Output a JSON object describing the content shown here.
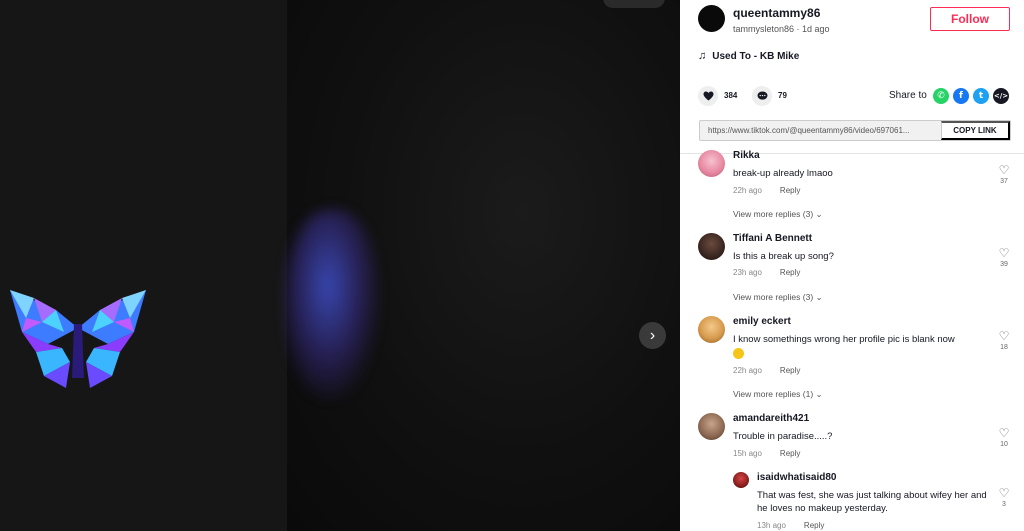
{
  "post": {
    "author_handle": "queentammy86",
    "author_subline": "tammysleton86 · 1d ago",
    "follow_label": "Follow",
    "music": "Used To - KB Mike",
    "likes": "384",
    "comments": "79",
    "share_label": "Share to",
    "link": "https://www.tiktok.com/@queentammy86/video/697061...",
    "copy_link_label": "COPY LINK"
  },
  "video": {
    "next_icon": "›"
  },
  "comments": [
    {
      "name": "Rikka",
      "text": "break-up already lmaoo",
      "time": "22h ago",
      "reply": "Reply",
      "likes": "37",
      "view_more": "View more replies (3) ⌄"
    },
    {
      "name": "Tiffani A Bennett",
      "text": "Is this a break up song?",
      "time": "23h ago",
      "reply": "Reply",
      "likes": "39",
      "view_more": "View more replies (3) ⌄"
    },
    {
      "name": "emily eckert",
      "text": "I know somethings wrong her profile pic is blank now",
      "time": "22h ago",
      "reply": "Reply",
      "likes": "18",
      "view_more": "View more replies (1) ⌄"
    },
    {
      "name": "amandareith421",
      "text": "Trouble in paradise.....?",
      "time": "15h ago",
      "reply": "Reply",
      "likes": "10"
    }
  ],
  "reply": {
    "name": "isaidwhatisaid80",
    "text": "That was fest, she was just talking about wifey her and he loves no makeup yesterday.",
    "time": "13h ago",
    "reply": "Reply",
    "likes": "3"
  },
  "colors": {
    "follow_accent": "#fe2c55",
    "whatsapp": "#25d366",
    "facebook": "#1877f2",
    "twitter": "#1da1f2",
    "embed": "#161823"
  },
  "icons": {
    "heart": "♡",
    "music": "♫"
  }
}
